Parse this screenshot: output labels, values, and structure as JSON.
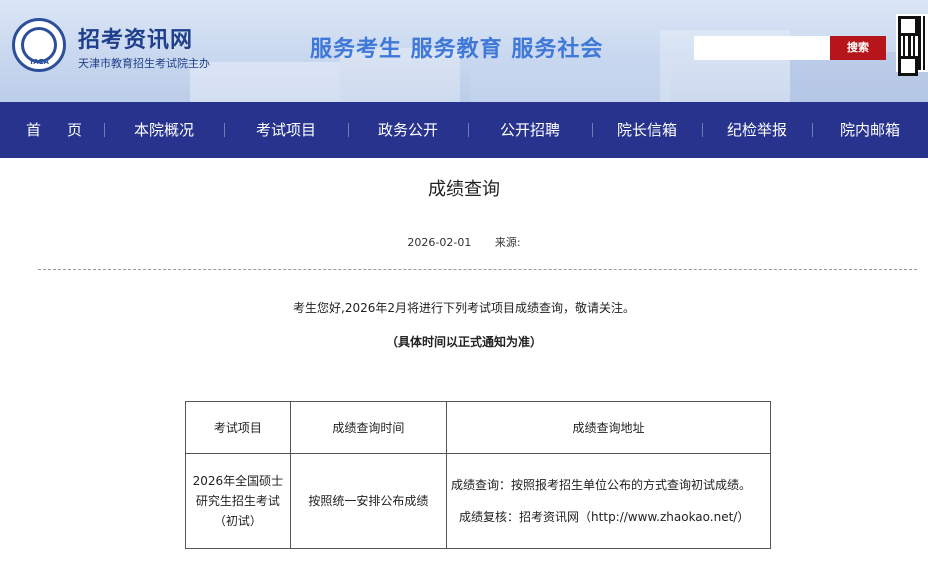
{
  "header": {
    "logo_text": "TAEA",
    "site_title": "招考资讯网",
    "site_subtitle": "天津市教育招生考试院主办",
    "slogan": "服务考生  服务教育  服务社会",
    "search": {
      "value": "",
      "button_label": "搜索"
    }
  },
  "nav": {
    "items": [
      {
        "label": "首页"
      },
      {
        "label": "本院概况"
      },
      {
        "label": "考试项目"
      },
      {
        "label": "政务公开"
      },
      {
        "label": "公开招聘"
      },
      {
        "label": "院长信箱"
      },
      {
        "label": "纪检举报"
      },
      {
        "label": "院内邮箱"
      }
    ],
    "colors": {
      "background": "#27338c",
      "text": "#ffffff"
    }
  },
  "article": {
    "title": "成绩查询",
    "date": "2026-02-01",
    "source_label": "来源:",
    "intro": "考生您好,2026年2月将进行下列考试项目成绩查询，敬请关注。",
    "note": "（具体时间以正式通知为准）"
  },
  "table": {
    "headers": [
      "考试项目",
      "成绩查询时间",
      "成绩查询地址"
    ],
    "rows": [
      {
        "project_lines": [
          "2026年全国硕士",
          "研究生招生考试",
          "（初试）"
        ],
        "time": "按照统一安排公布成绩",
        "address_lines": [
          "成绩查询：按照报考招生单位公布的方式查询初试成绩。",
          "成绩复核：招考资讯网（http://www.zhaokao.net/）"
        ]
      }
    ]
  },
  "colors": {
    "search_button": "#b5151b",
    "title_blue": "#1f3f8c",
    "slogan_blue": "#3f78d8"
  }
}
